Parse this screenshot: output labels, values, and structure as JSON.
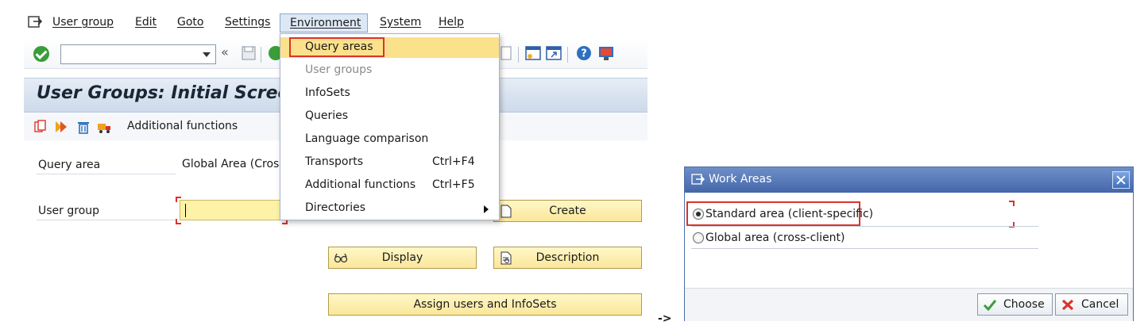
{
  "menubar": {
    "items": [
      "User group",
      "Edit",
      "Goto",
      "Settings",
      "Environment",
      "System",
      "Help"
    ]
  },
  "screen": {
    "title": "User Groups: Initial Scree",
    "app_toolbar_label": "Additional functions",
    "fields": {
      "query_area_label": "Query area",
      "query_area_value": "Global Area (Cross",
      "user_group_label": "User group",
      "user_group_value": ""
    },
    "buttons": {
      "create": "Create",
      "display": "Display",
      "description": "Description",
      "assign": "Assign users and InfoSets"
    }
  },
  "dropdown": {
    "items": [
      {
        "label": "Query areas",
        "shortcut": "",
        "state": "highlighted-boxed"
      },
      {
        "label": "User groups",
        "shortcut": "",
        "state": "disabled"
      },
      {
        "label": "InfoSets",
        "shortcut": "",
        "state": "normal"
      },
      {
        "label": "Queries",
        "shortcut": "",
        "state": "normal"
      },
      {
        "label": "Language comparison",
        "shortcut": "",
        "state": "normal"
      },
      {
        "label": "Transports",
        "shortcut": "Ctrl+F4",
        "state": "normal"
      },
      {
        "label": "Additional functions",
        "shortcut": "Ctrl+F5",
        "state": "normal"
      },
      {
        "label": "Directories",
        "shortcut": "",
        "state": "submenu"
      }
    ]
  },
  "arrow_text": "->",
  "dialog": {
    "title": "Work Areas",
    "options": [
      {
        "label": "Standard area (client-specific)",
        "selected": true
      },
      {
        "label": "Global area (cross-client)",
        "selected": false
      }
    ],
    "choose_label": "Choose",
    "cancel_label": "Cancel"
  },
  "colors": {
    "highlight_box": "#d9342b",
    "menu_highlight": "#fbe18c",
    "input_yellow": "#fdf2a6",
    "dialog_title_bar": "#4467ab"
  }
}
